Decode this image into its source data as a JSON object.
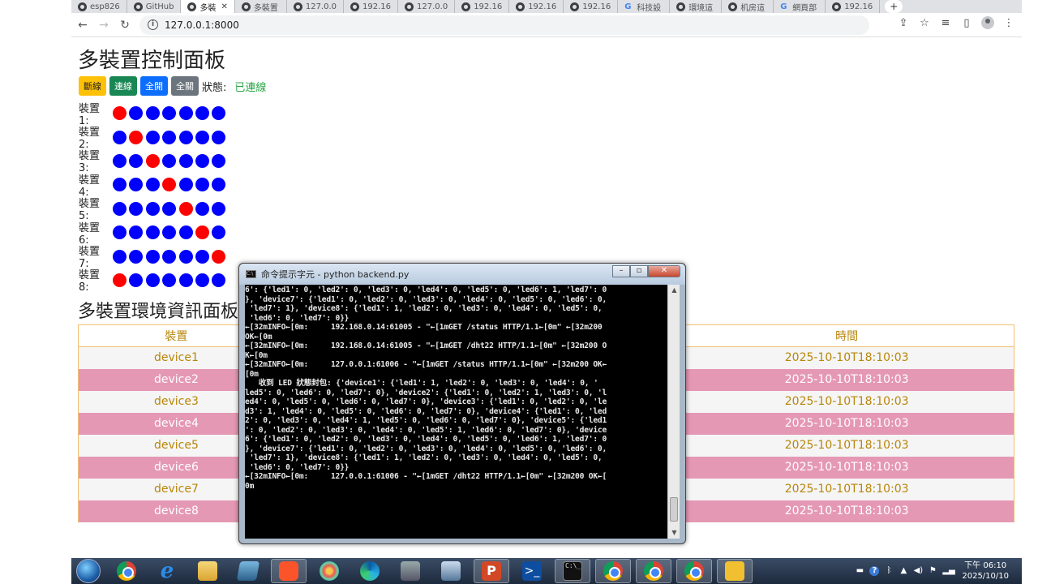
{
  "browser": {
    "tabs": [
      {
        "label": "esp826",
        "icon": "github-icon"
      },
      {
        "label": "GitHub",
        "icon": "github-icon"
      },
      {
        "label": "多裝",
        "icon": "globe-icon",
        "active": true
      },
      {
        "label": "多裝置",
        "icon": "globe-icon"
      },
      {
        "label": "127.0.0",
        "icon": "globe-icon"
      },
      {
        "label": "192.16",
        "icon": "globe-icon"
      },
      {
        "label": "127.0.0",
        "icon": "globe-icon"
      },
      {
        "label": "192.16",
        "icon": "globe-icon"
      },
      {
        "label": "192.16",
        "icon": "globe-icon"
      },
      {
        "label": "192.16",
        "icon": "globe-icon"
      },
      {
        "label": "科技設",
        "icon": "google-icon"
      },
      {
        "label": "環境這",
        "icon": "app-icon"
      },
      {
        "label": "机房這",
        "icon": "app-icon"
      },
      {
        "label": "網頁部",
        "icon": "google-icon"
      },
      {
        "label": "192.16",
        "icon": "globe-icon"
      }
    ],
    "url": "127.0.0.1:8000"
  },
  "panel": {
    "title": "多裝置控制面板",
    "buttons": {
      "disconnect": "斷線",
      "connect": "連線",
      "all_on": "全開",
      "all_off": "全關"
    },
    "status_label": "狀態:",
    "status_value": "已連線",
    "colors": {
      "led_off": "#0000ff",
      "led_on": "#ff0000",
      "status": "#28a745"
    },
    "devices": [
      {
        "label": "裝置 1:",
        "leds": [
          1,
          0,
          0,
          0,
          0,
          0,
          0
        ]
      },
      {
        "label": "裝置 2:",
        "leds": [
          0,
          1,
          0,
          0,
          0,
          0,
          0
        ]
      },
      {
        "label": "裝置 3:",
        "leds": [
          0,
          0,
          1,
          0,
          0,
          0,
          0
        ]
      },
      {
        "label": "裝置 4:",
        "leds": [
          0,
          0,
          0,
          1,
          0,
          0,
          0
        ]
      },
      {
        "label": "裝置 5:",
        "leds": [
          0,
          0,
          0,
          0,
          1,
          0,
          0
        ]
      },
      {
        "label": "裝置 6:",
        "leds": [
          0,
          0,
          0,
          0,
          0,
          1,
          0
        ]
      },
      {
        "label": "裝置 7:",
        "leds": [
          0,
          0,
          0,
          0,
          0,
          0,
          1
        ]
      },
      {
        "label": "裝置 8:",
        "leds": [
          1,
          0,
          0,
          0,
          0,
          0,
          0
        ]
      }
    ]
  },
  "env": {
    "title": "多裝置環境資訊面板",
    "headers": [
      "裝置",
      "時間"
    ],
    "rows": [
      {
        "device": "device1",
        "time": "2025-10-10T18:10:03"
      },
      {
        "device": "device2",
        "time": "2025-10-10T18:10:03"
      },
      {
        "device": "device3",
        "time": "2025-10-10T18:10:03"
      },
      {
        "device": "device4",
        "time": "2025-10-10T18:10:03"
      },
      {
        "device": "device5",
        "time": "2025-10-10T18:10:03"
      },
      {
        "device": "device6",
        "time": "2025-10-10T18:10:03"
      },
      {
        "device": "device7",
        "time": "2025-10-10T18:10:03"
      },
      {
        "device": "device8",
        "time": "2025-10-10T18:10:03"
      }
    ]
  },
  "cmd": {
    "title": "命令提示字元 - python  backend.py",
    "lines": [
      "6': {'led1': 0, 'led2': 0, 'led3': 0, 'led4': 0, 'led5': 0, 'led6': 1, 'led7': 0",
      "}, 'device7': {'led1': 0, 'led2': 0, 'led3': 0, 'led4': 0, 'led5': 0, 'led6': 0,",
      " 'led7': 1}, 'device8': {'led1': 1, 'led2': 0, 'led3': 0, 'led4': 0, 'led5': 0,",
      " 'led6': 0, 'led7': 0}}",
      "←[32mINFO←[0m:     192.168.0.14:61005 - \"←[1mGET /status HTTP/1.1←[0m\" ←[32m200",
      "OK←[0m",
      "←[32mINFO←[0m:     192.168.0.14:61005 - \"←[1mGET /dht22 HTTP/1.1←[0m\" ←[32m200 O",
      "K←[0m",
      "←[32mINFO←[0m:     127.0.0.1:61006 - \"←[1mGET /status HTTP/1.1←[0m\" ←[32m200 OK←",
      "[0m",
      "   收到 LED 狀態封包: {'device1': {'led1': 1, 'led2': 0, 'led3': 0, 'led4': 0, '",
      "led5': 0, 'led6': 0, 'led7': 0}, 'device2': {'led1': 0, 'led2': 1, 'led3': 0, 'l",
      "ed4': 0, 'led5': 0, 'led6': 0, 'led7': 0}, 'device3': {'led1': 0, 'led2': 0, 'le",
      "d3': 1, 'led4': 0, 'led5': 0, 'led6': 0, 'led7': 0}, 'device4': {'led1': 0, 'led",
      "2': 0, 'led3': 0, 'led4': 1, 'led5': 0, 'led6': 0, 'led7': 0}, 'device5': {'led1",
      "': 0, 'led2': 0, 'led3': 0, 'led4': 0, 'led5': 1, 'led6': 0, 'led7': 0}, 'device",
      "6': {'led1': 0, 'led2': 0, 'led3': 0, 'led4': 0, 'led5': 0, 'led6': 1, 'led7': 0",
      "}, 'device7': {'led1': 0, 'led2': 0, 'led3': 0, 'led4': 0, 'led5': 0, 'led6': 0,",
      " 'led7': 1}, 'device8': {'led1': 1, 'led2': 0, 'led3': 0, 'led4': 0, 'led5': 0,",
      " 'led6': 0, 'led7': 0}}",
      "←[32mINFO←[0m:     127.0.0.1:61006 - \"←[1mGET /dht22 HTTP/1.1←[0m\" ←[32m200 OK←[",
      "0m"
    ]
  },
  "taskbar": {
    "clock_time": "下午 06:10",
    "clock_date": "2025/10/10"
  }
}
